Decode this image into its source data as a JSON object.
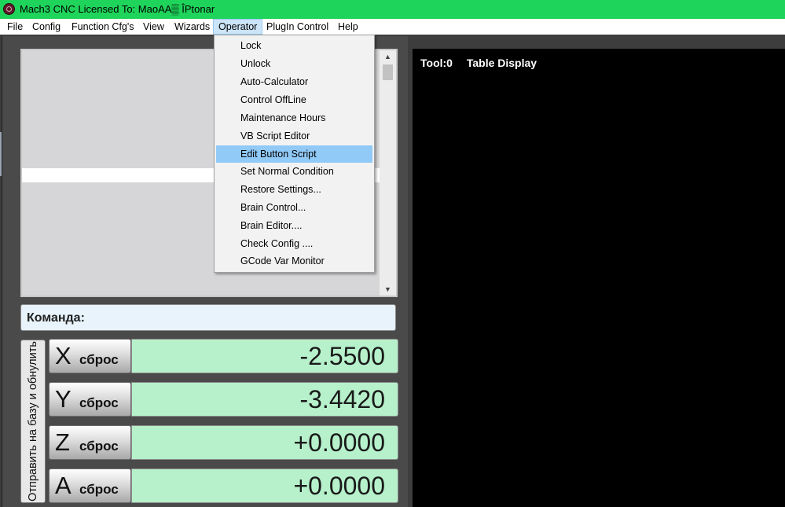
{
  "titlebar": {
    "title": "Mach3 CNC  Licensed To: MaoAA▒ ÎPtonar"
  },
  "menubar": {
    "items": [
      "File",
      "Config",
      "Function Cfg's",
      "View",
      "Wizards",
      "Operator",
      "PlugIn Control",
      "Help"
    ],
    "active": "Operator"
  },
  "operator_menu": {
    "items": [
      "Lock",
      "Unlock",
      "Auto-Calculator",
      "Control OffLine",
      "Maintenance Hours",
      "VB Script Editor",
      "Edit Button Script",
      "Set Normal Condition",
      "Restore Settings...",
      "Brain Control...",
      "Brain Editor....",
      "Check Config ....",
      "GCode Var Monitor"
    ],
    "highlighted": "Edit Button Script"
  },
  "command": {
    "label": "Команда:"
  },
  "ref_all": {
    "label": "Отправить на базу и обнулить"
  },
  "axes": [
    {
      "letter": "X",
      "ref_label": "сброс",
      "value": "-2.5500"
    },
    {
      "letter": "Y",
      "ref_label": "сброс",
      "value": "-3.4420"
    },
    {
      "letter": "Z",
      "ref_label": "сброс",
      "value": "+0.0000"
    },
    {
      "letter": "A",
      "ref_label": "сброс",
      "value": "+0.0000"
    }
  ],
  "toolpath": {
    "tool": "Tool:0",
    "display": "Table Display"
  },
  "colors": {
    "titlebar": "#1fd45a",
    "dro_bg": "#b6f1cb",
    "menu_highlight": "#91c9f7",
    "toolpath_bg": "#000000"
  }
}
